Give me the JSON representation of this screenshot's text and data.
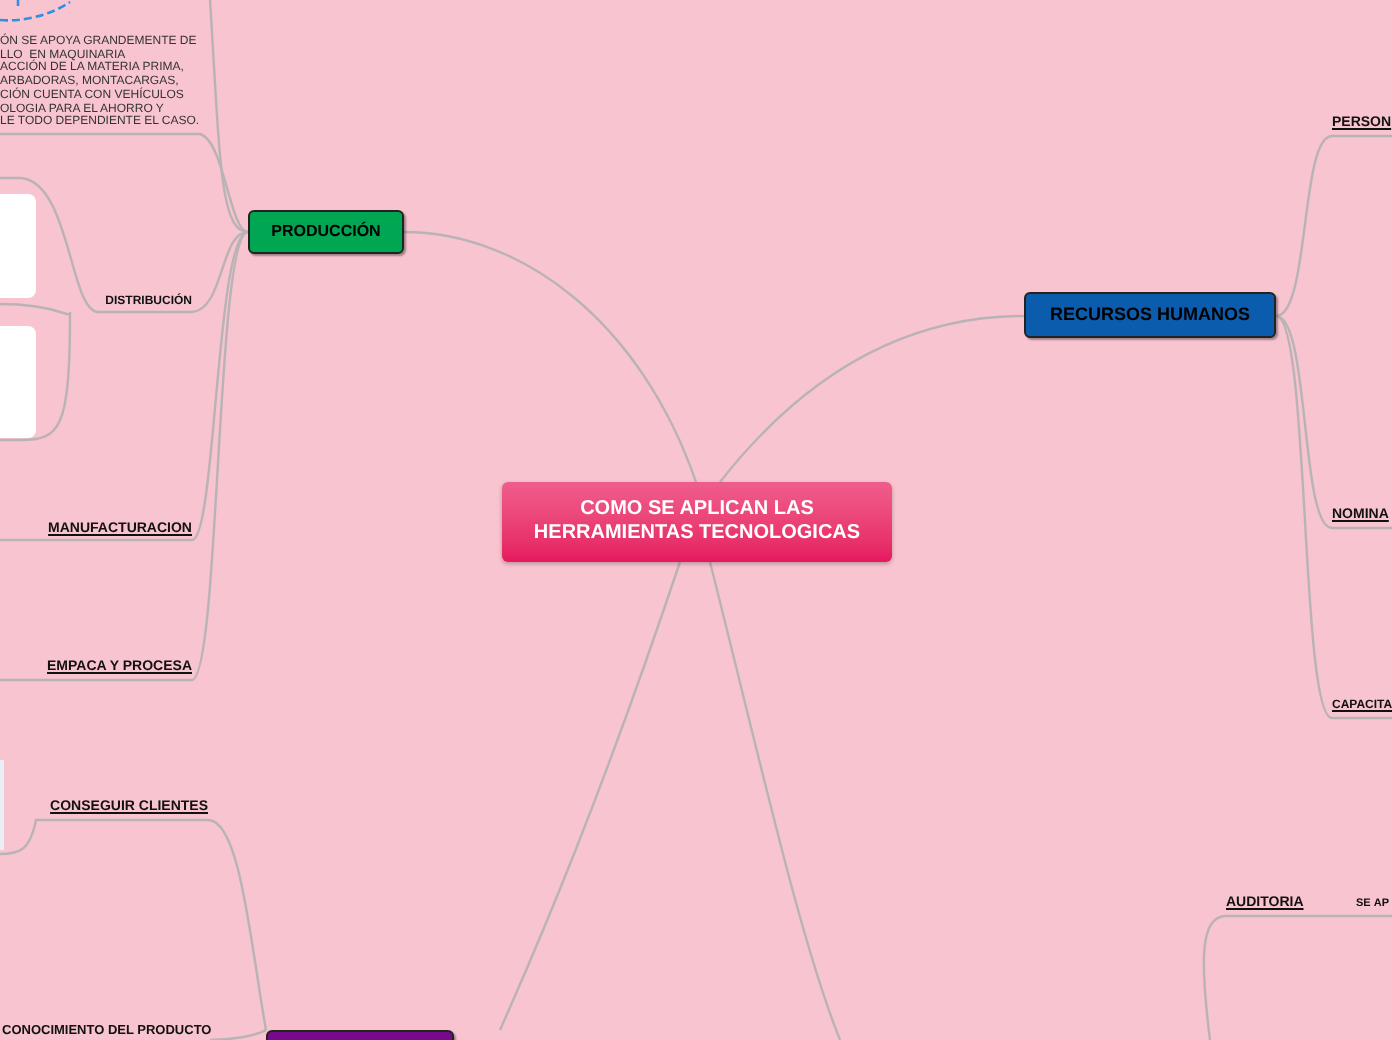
{
  "central": {
    "title": "COMO SE APLICAN LAS HERRAMIENTAS TECNOLOGICAS"
  },
  "main_topics": [
    {
      "label": "PRODUCCIÓN",
      "color": "#00a651"
    },
    {
      "label": "RECURSOS HUMANOS",
      "color": "#0b5cad"
    },
    {
      "color": "#760a8a"
    }
  ],
  "note": {
    "lines": [
      "ÓN SE APOYA GRANDEMENTE DE",
      "LLO  EN MAQUINARIA",
      "ACCIÓN DE LA MATERIA PRIMA,",
      "ARBADORAS, MONTACARGAS,",
      "CIÓN CUENTA CON VEHÍCULOS",
      "OLOGIA PARA EL AHORRO Y",
      "LE TODO DEPENDIENTE EL CASO."
    ]
  },
  "subtopics": [
    {
      "label": "DISTRIBUCIÓN",
      "underlined": false
    },
    {
      "label": "MANUFACTURACION",
      "underlined": true
    },
    {
      "label": "EMPACA Y PROCESA",
      "underlined": true
    },
    {
      "label": "CONSEGUIR CLIENTES",
      "underlined": true
    },
    {
      "label": "CONOCIMIENTO DEL PRODUCTO"
    },
    {
      "label": "PERSON",
      "underlined": true
    },
    {
      "label": "NOMINA",
      "underlined": true
    },
    {
      "label": "CAPACITA",
      "underlined": true
    },
    {
      "label": "AUDITORIA",
      "underlined": true
    },
    {
      "label": "SE **AP**",
      "underlined": false
    }
  ]
}
